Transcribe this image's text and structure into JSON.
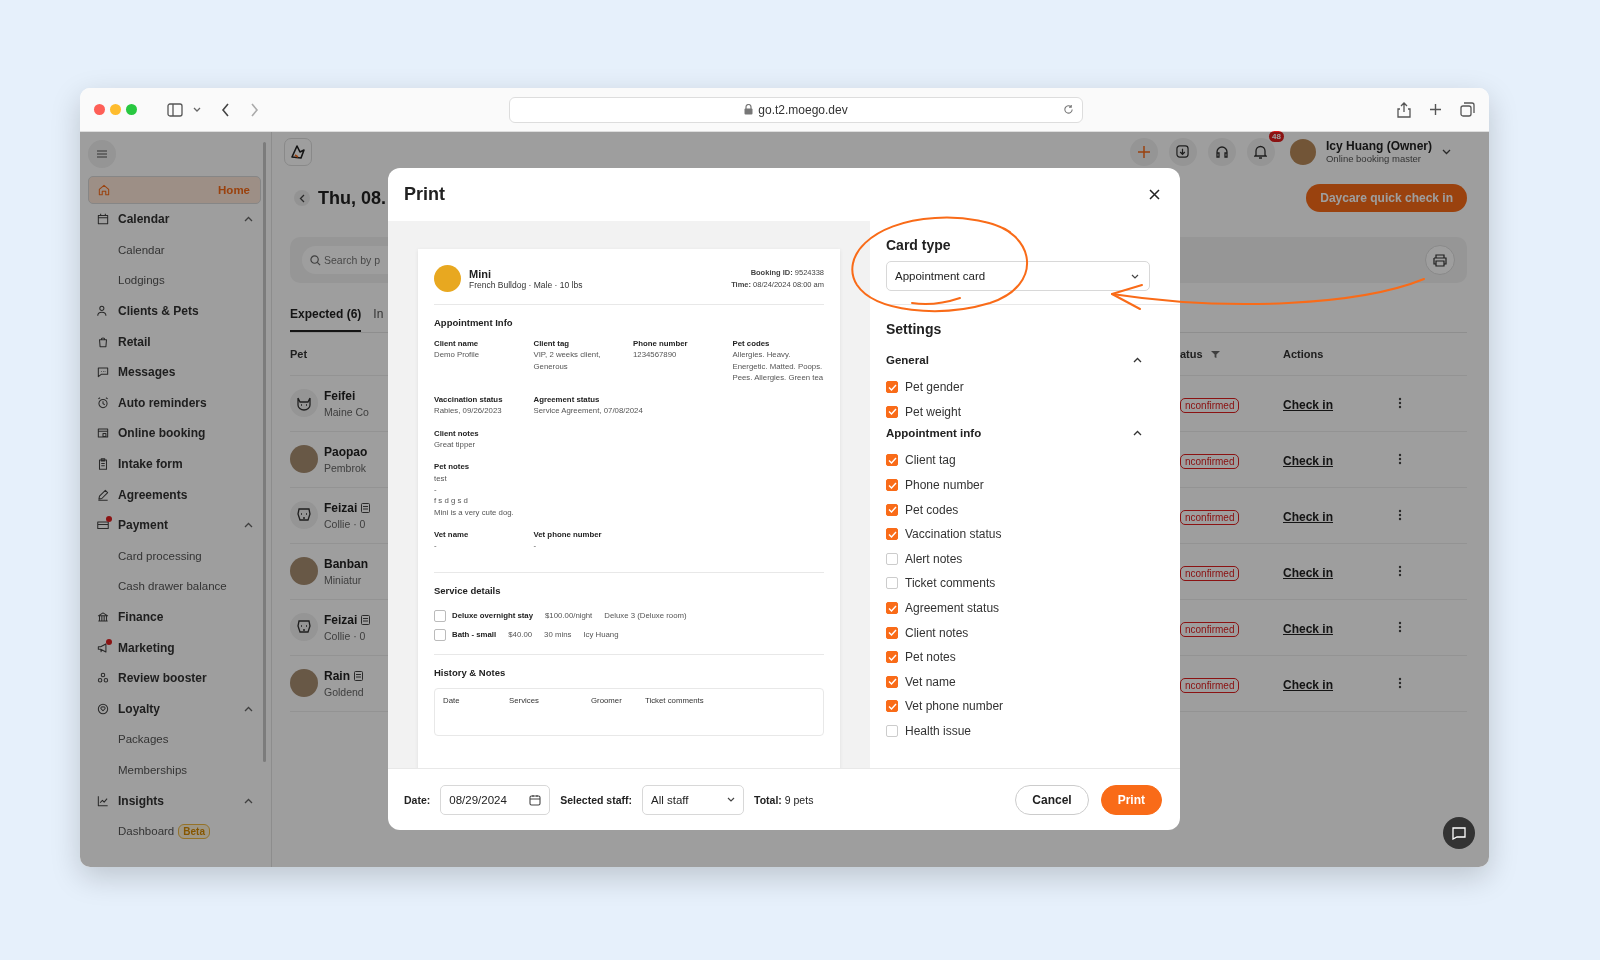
{
  "browser": {
    "url": "go.t2.moego.dev"
  },
  "sidebar": {
    "items": [
      {
        "label": "Home",
        "selected": true,
        "alert": false
      },
      {
        "label": "Calendar",
        "selected": false,
        "alert": false,
        "expanded": true,
        "children": [
          {
            "label": "Calendar",
            "selected": false
          },
          {
            "label": "Lodgings",
            "selected": false
          }
        ]
      },
      {
        "label": "Clients & Pets",
        "selected": false,
        "alert": false
      },
      {
        "label": "Retail",
        "selected": false,
        "alert": false
      },
      {
        "label": "Messages",
        "selected": false,
        "alert": false
      },
      {
        "label": "Auto reminders",
        "selected": false,
        "alert": false
      },
      {
        "label": "Online booking",
        "selected": false,
        "alert": false
      },
      {
        "label": "Intake form",
        "selected": false,
        "alert": false
      },
      {
        "label": "Agreements",
        "selected": false,
        "alert": false
      },
      {
        "label": "Payment",
        "selected": false,
        "alert": true,
        "expanded": true,
        "children": [
          {
            "label": "Card processing",
            "selected": false
          },
          {
            "label": "Cash drawer balance",
            "selected": false
          }
        ]
      },
      {
        "label": "Finance",
        "selected": false,
        "alert": false
      },
      {
        "label": "Marketing",
        "selected": false,
        "alert": true
      },
      {
        "label": "Review booster",
        "selected": false,
        "alert": false
      },
      {
        "label": "Loyalty",
        "selected": false,
        "alert": false,
        "expanded": true,
        "children": [
          {
            "label": "Packages",
            "selected": false
          },
          {
            "label": "Memberships",
            "selected": false
          }
        ]
      },
      {
        "label": "Insights",
        "selected": false,
        "alert": false,
        "expanded": true,
        "children": [
          {
            "label": "Dashboard",
            "selected": false,
            "badge": "Beta"
          }
        ]
      }
    ]
  },
  "topbar": {
    "notifications": "48",
    "user": {
      "name": "Icy Huang (Owner)",
      "role": "Online booking master"
    }
  },
  "page": {
    "date_title": "Thu, 08.",
    "quick_action": "Daycare quick check in",
    "search": {
      "placeholder": "Search by p"
    },
    "tabs": [
      {
        "label": "Expected (6)",
        "selected": true
      },
      {
        "label": "In",
        "selected": false
      }
    ],
    "table": {
      "columns": [
        "Pet",
        "atus",
        "Actions"
      ],
      "rows": [
        {
          "kind": "cat",
          "name": "Feifei",
          "note": false,
          "breed": "Maine Co",
          "status": "nconfirmed",
          "action": "Check in"
        },
        {
          "kind": "photo",
          "name": "Paopao",
          "note": false,
          "breed": "Pembrok",
          "status": "nconfirmed",
          "action": "Check in"
        },
        {
          "kind": "dog",
          "name": "Feizai",
          "note": true,
          "breed": "Collie · 0",
          "status": "nconfirmed",
          "action": "Check in"
        },
        {
          "kind": "photo",
          "name": "Banban",
          "note": false,
          "breed": "Miniatur",
          "status": "nconfirmed",
          "action": "Check in"
        },
        {
          "kind": "dog",
          "name": "Feizai",
          "note": true,
          "breed": "Collie · 0",
          "status": "nconfirmed",
          "action": "Check in"
        },
        {
          "kind": "photo",
          "name": "Rain",
          "note": true,
          "breed": "Goldend",
          "status": "nconfirmed",
          "action": "Check in"
        }
      ]
    }
  },
  "print_dialog": {
    "title": "Print",
    "preview": {
      "pet": {
        "name": "Mini",
        "details": "French Bulldog · Male · 10 lbs",
        "booking": "**Booking ID:** 9524338",
        "time": "**Time:** 08/24/2024 08:00 am"
      },
      "appointment_info": {
        "title": "Appointment Info",
        "rows": [
          [
            {
              "label": "Client name",
              "value": "Demo Profile"
            },
            {
              "label": "Client tag",
              "value": "VIP, 2 weeks client, Generous"
            },
            {
              "label": "Phone number",
              "value": "1234567890"
            },
            {
              "label": "Pet codes",
              "value": "Allergies. Heavy. Energetic. Matted. Poops. Pees. Allergies. Green tea"
            }
          ],
          [
            {
              "label": "Vaccination status",
              "value": "Rabies, 09/26/2023"
            },
            {
              "label": "Agreement status",
              "value": "Service Agreement, 07/08/2024"
            }
          ],
          [
            {
              "label": "Client notes",
              "value": "Great tipper"
            }
          ],
          [
            {
              "label": "Pet notes",
              "value": [
                "test",
                "-",
                "f s d g s d",
                "Mini is a very cute dog."
              ]
            }
          ],
          [
            {
              "label": "Vet name",
              "value": "-"
            },
            {
              "label": "Vet phone number",
              "value": "-"
            }
          ]
        ]
      },
      "service_details": {
        "title": "Service details",
        "items": [
          {
            "checked": false,
            "name": "Deluxe overnight stay",
            "cells": [
              "$100.00/night",
              "Deluxe 3 (Deluxe room)"
            ]
          },
          {
            "checked": false,
            "name": "Bath - small",
            "cells": [
              "$40.00",
              "30 mins",
              "Icy Huang"
            ]
          }
        ]
      },
      "history": {
        "title": "History & Notes",
        "columns": [
          "Date",
          "Services",
          "Groomer",
          "Ticket comments"
        ]
      }
    },
    "settings": {
      "card_type": {
        "label": "Card type",
        "value": "Appointment card"
      },
      "title": "Settings",
      "groups": [
        {
          "title": "General",
          "expanded": true,
          "options": [
            {
              "label": "Pet gender",
              "checked": true
            },
            {
              "label": "Pet weight",
              "checked": true
            }
          ]
        },
        {
          "title": "Appointment info",
          "expanded": true,
          "options": [
            {
              "label": "Client tag",
              "checked": true
            },
            {
              "label": "Phone number",
              "checked": true
            },
            {
              "label": "Pet codes",
              "checked": true
            },
            {
              "label": "Vaccination status",
              "checked": true
            },
            {
              "label": "Alert notes",
              "checked": false
            },
            {
              "label": "Ticket comments",
              "checked": false
            },
            {
              "label": "Agreement status",
              "checked": true
            },
            {
              "label": "Client notes",
              "checked": true
            },
            {
              "label": "Pet notes",
              "checked": true
            },
            {
              "label": "Vet name",
              "checked": true
            },
            {
              "label": "Vet phone number",
              "checked": true
            },
            {
              "label": "Health issue",
              "checked": false
            }
          ]
        }
      ]
    },
    "footer": {
      "date": {
        "label": "Date:",
        "value": "08/29/2024"
      },
      "staff": {
        "label": "Selected staff:",
        "value": "All staff"
      },
      "total": "**Total:** 9 pets",
      "buttons": [
        {
          "label": "Cancel",
          "kind": "secondary"
        },
        {
          "label": "Print",
          "kind": "primary"
        }
      ]
    }
  }
}
